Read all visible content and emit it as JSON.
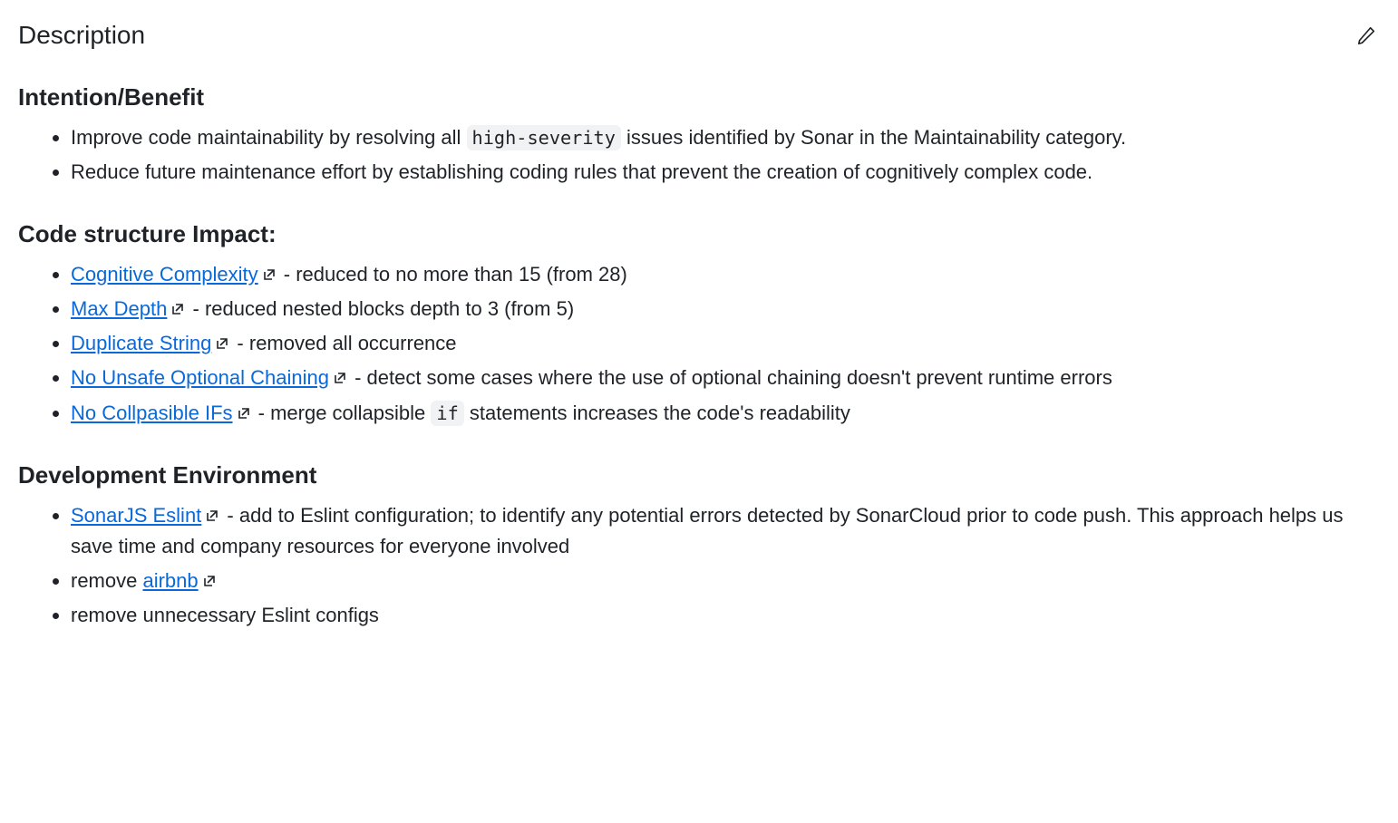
{
  "header": {
    "title": "Description"
  },
  "sections": {
    "intention": {
      "heading": "Intention/Benefit",
      "items": [
        {
          "pre": "Improve code maintainability by resolving all ",
          "code": "high-severity",
          "post": " issues identified by Sonar in the Maintainability category."
        },
        {
          "pre": "Reduce future maintenance effort by establishing coding rules that prevent the creation of cognitively complex code."
        }
      ]
    },
    "impact": {
      "heading": "Code structure Impact:",
      "items": [
        {
          "link": "Cognitive Complexity",
          "post": " - reduced to no more than 15 (from 28)"
        },
        {
          "link": "Max Depth",
          "post": " - reduced nested blocks depth to 3 (from 5)"
        },
        {
          "link": "Duplicate String",
          "post": " - removed all occurrence"
        },
        {
          "link": "No Unsafe Optional Chaining",
          "post": " - detect some cases where the use of optional chaining doesn't prevent runtime errors"
        },
        {
          "link": "No Collpasible IFs",
          "post_pre": " - merge collapsible ",
          "code": "if",
          "post": " statements increases the code's readability"
        }
      ]
    },
    "devenv": {
      "heading": "Development Environment",
      "items": [
        {
          "link": "SonarJS Eslint",
          "post": " - add to Eslint configuration; to identify any potential errors detected by SonarCloud prior to code push. This approach helps us save time and company resources for everyone involved"
        },
        {
          "pre": "remove ",
          "link": "airbnb"
        },
        {
          "pre": "remove unnecessary Eslint configs"
        }
      ]
    }
  }
}
